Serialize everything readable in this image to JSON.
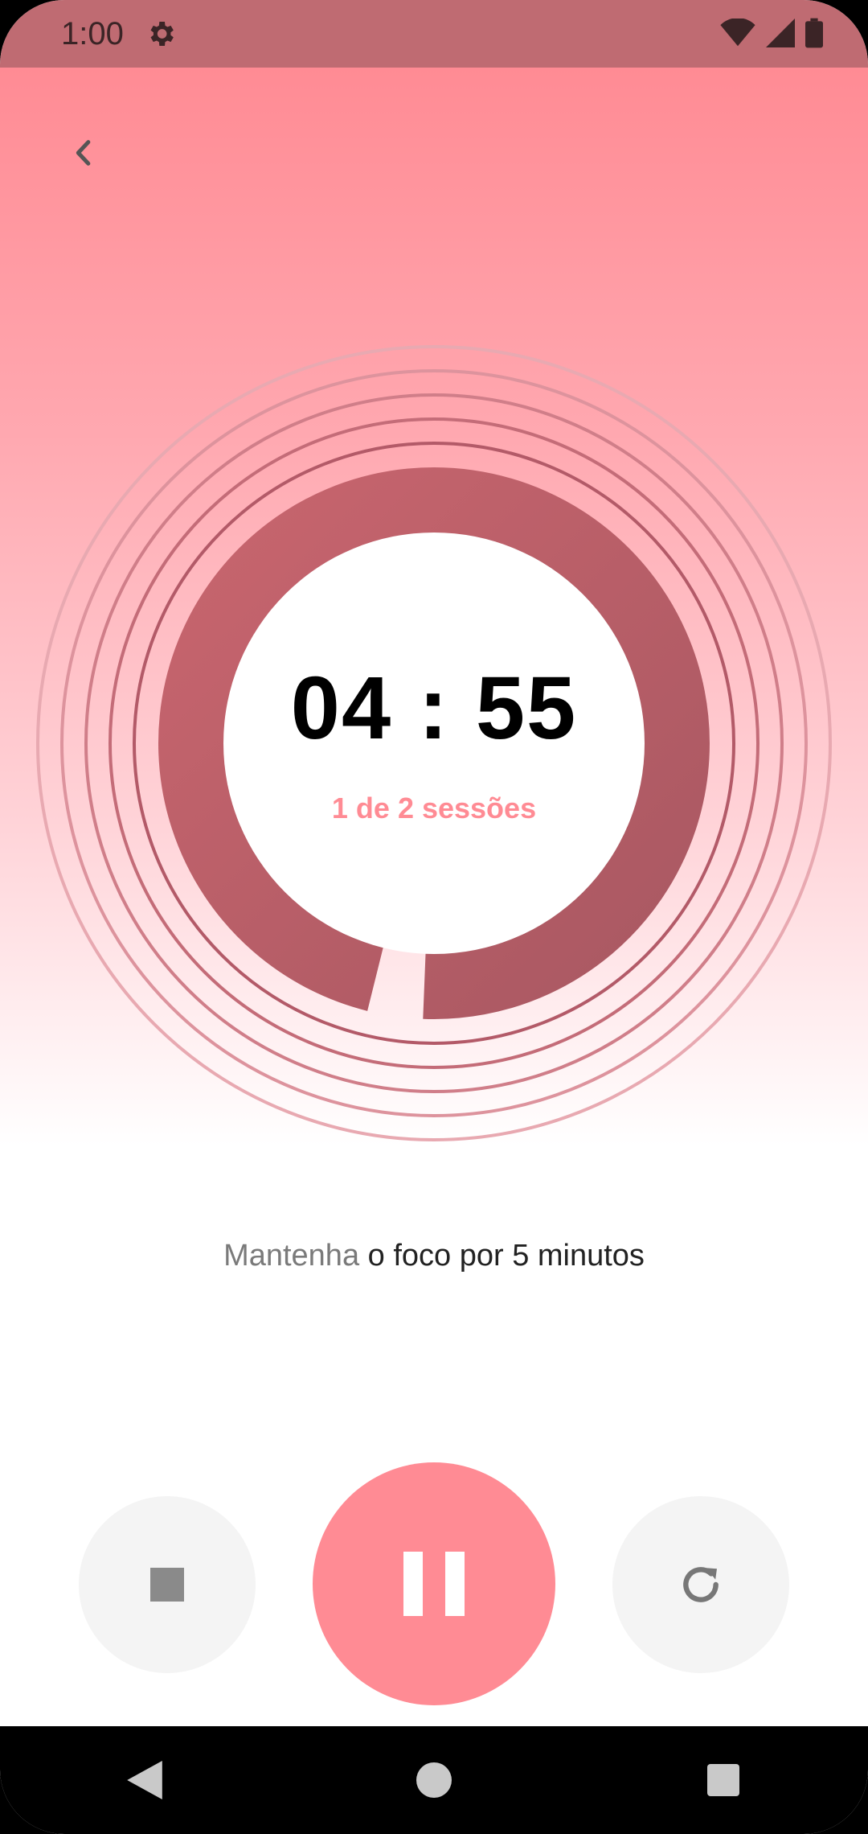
{
  "status_bar": {
    "time": "1:00",
    "icons": [
      "gear-icon",
      "wifi-icon",
      "signal-icon",
      "battery-icon"
    ]
  },
  "header": {
    "back_icon": "chevron-left-icon"
  },
  "timer": {
    "time": "04 : 55",
    "session": "1 de 2 sessões",
    "progress": 0.98,
    "colors": {
      "ring_start": "#c8656e",
      "ring_end": "#a95862",
      "accent": "#ff8b94"
    }
  },
  "focus_message": {
    "part1": "Mantenha",
    "part2": " o foco por 5 minutos"
  },
  "controls": {
    "stop_icon": "stop-icon",
    "pause_icon": "pause-icon",
    "reset_icon": "reset-icon"
  },
  "nav_bar": {
    "icons": [
      "back-triangle-icon",
      "home-circle-icon",
      "recents-square-icon"
    ]
  }
}
